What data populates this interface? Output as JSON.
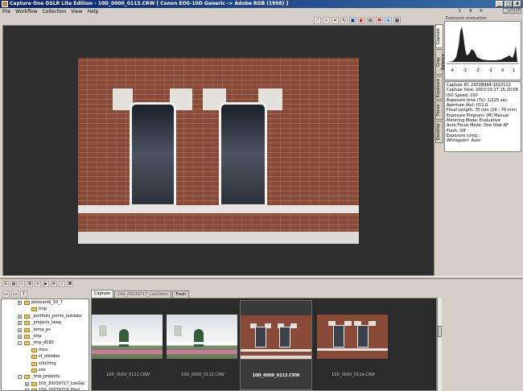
{
  "window": {
    "title": "Capture One DSLR Lite Edition  -  10D_0000_0113.CRW  [ Canon EOS-10D Generic -> Adobe RGB (1998) ]",
    "min": "_",
    "max": "□",
    "close": "x"
  },
  "menu": [
    "File",
    "Workflow",
    "Collection",
    "View",
    "Help"
  ],
  "coords": {
    "a": "1",
    "b": "0",
    "c": "0"
  },
  "toolbar_icons": [
    "eyedropper-icon",
    "zoom-icon",
    "crop-icon",
    "rotate-icon",
    "color-picker-icon",
    "white-balance-icon",
    "levels-icon",
    "overexposure-icon",
    "focus-mask-icon",
    "grid-icon"
  ],
  "right_panel": {
    "tabs": [
      "Capture",
      "Gray Balance",
      "Exposure",
      "Focus",
      "Develop"
    ],
    "histogram_title": "Exposure evaluation",
    "histogram_ticks": [
      "-4",
      "-3",
      "-2",
      "-1",
      "0",
      "1"
    ],
    "info_lines": [
      "Capture ID: 2301B494-1010113",
      "Capture time: 2003:03:17 15:20:08",
      "ISO Speed: 100",
      "Exposure time (Tv): 1/125 sec.",
      "Aperture (Av): f/11.0",
      "Focal Length: 70 mm (24 - 70 mm)",
      "Exposure Program: (M) Manual",
      "Metering Mode: Evaluative",
      "Auto Focus Mode: One Shot AF",
      "Flash: Off",
      "Exposure comp.:",
      "Whitepoint: Auto"
    ]
  },
  "browser": {
    "tabs": [
      {
        "label": "Capture",
        "active": true
      },
      {
        "label": "10d_20030717_LosGatos",
        "active": false
      },
      {
        "label": "Trash",
        "active": false
      }
    ],
    "thumbnails": [
      {
        "name": "10D_0000_0111.CRW",
        "kind": "house",
        "selected": false
      },
      {
        "name": "10D_0000_0112.CRW",
        "kind": "house",
        "selected": false
      },
      {
        "name": "10D_0000_0113.CRW",
        "kind": "brick",
        "selected": true
      },
      {
        "name": "10D_0000_0114.CRW",
        "kind": "brick",
        "selected": false
      }
    ]
  },
  "folders": [
    {
      "label": "postcards_10_7",
      "indent": 2,
      "expand": "+"
    },
    {
      "label": "tmp",
      "indent": 3,
      "expand": ""
    },
    {
      "label": "_portfolio_prints_outdate",
      "indent": 2,
      "expand": "+"
    },
    {
      "label": "_projects_keep",
      "indent": 2,
      "expand": "+"
    },
    {
      "label": "_temp_ps",
      "indent": 2,
      "expand": "+"
    },
    {
      "label": "_tmp",
      "indent": 2,
      "expand": "+"
    },
    {
      "label": "_tmp_d180",
      "indent": 2,
      "expand": "-"
    },
    {
      "label": "misc",
      "indent": 3,
      "expand": ""
    },
    {
      "label": "cf_oldsdes",
      "indent": 3,
      "expand": ""
    },
    {
      "label": "stitching",
      "indent": 3,
      "expand": ""
    },
    {
      "label": "zoo",
      "indent": 3,
      "expand": ""
    },
    {
      "label": "_tmp_projects",
      "indent": 2,
      "expand": "-"
    },
    {
      "label": "10d_20030717_LosGat",
      "indent": 3,
      "expand": "+"
    },
    {
      "label": "10d_20030718_Filoli",
      "indent": 3,
      "expand": "+"
    }
  ]
}
